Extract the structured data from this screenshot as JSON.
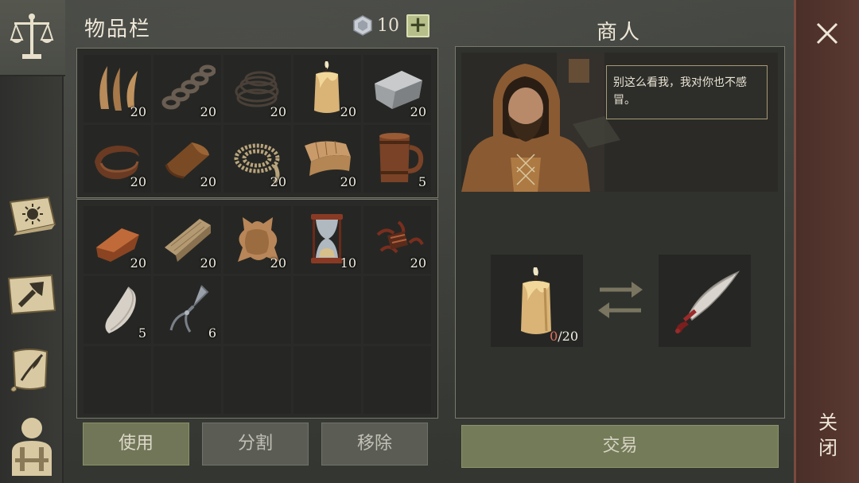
{
  "inventory": {
    "title": "物品栏",
    "currency_count": "10",
    "add_label": "+",
    "top_slots": [
      {
        "icon": "fiber-icon",
        "qty": "20"
      },
      {
        "icon": "chain-icon",
        "qty": "20"
      },
      {
        "icon": "wire-icon",
        "qty": "20"
      },
      {
        "icon": "candle-icon",
        "qty": "20"
      },
      {
        "icon": "stone-block-icon",
        "qty": "20"
      },
      {
        "icon": "leather-strip-icon",
        "qty": "20"
      },
      {
        "icon": "leather-roll-icon",
        "qty": "20"
      },
      {
        "icon": "rope-icon",
        "qty": "20"
      },
      {
        "icon": "cloth-icon",
        "qty": "20"
      },
      {
        "icon": "wooden-mug-icon",
        "qty": "5"
      }
    ],
    "bottom_slots": [
      {
        "icon": "copper-ingot-icon",
        "qty": "20"
      },
      {
        "icon": "wood-plank-icon",
        "qty": "20"
      },
      {
        "icon": "animal-hide-icon",
        "qty": "20"
      },
      {
        "icon": "hourglass-icon",
        "qty": "10"
      },
      {
        "icon": "scrap-pile-icon",
        "qty": "20"
      },
      {
        "icon": "fang-icon",
        "qty": "5"
      },
      {
        "icon": "fork-icon",
        "qty": "6"
      },
      {
        "icon": "",
        "qty": ""
      },
      {
        "icon": "",
        "qty": ""
      },
      {
        "icon": "",
        "qty": ""
      },
      {
        "icon": "",
        "qty": ""
      },
      {
        "icon": "",
        "qty": ""
      },
      {
        "icon": "",
        "qty": ""
      },
      {
        "icon": "",
        "qty": ""
      },
      {
        "icon": "",
        "qty": ""
      }
    ],
    "buttons": {
      "use": "使用",
      "split": "分割",
      "remove": "移除"
    }
  },
  "merchant": {
    "title": "商人",
    "speech": "别这么看我，我对你也不感冒。",
    "give_item": {
      "icon": "candle-icon",
      "have": "0",
      "need": "/20"
    },
    "get_item": {
      "icon": "scimitar-icon"
    },
    "trade_label": "交易"
  },
  "close": {
    "label": "关闭"
  },
  "sidebar": [
    {
      "icon": "scales-icon",
      "active": true
    },
    {
      "icon": "sun-book-icon"
    },
    {
      "icon": "hammer-map-icon"
    },
    {
      "icon": "quill-scroll-icon"
    },
    {
      "icon": "character-icon"
    }
  ],
  "colors": {
    "accent_green": "#737b58",
    "close_bar": "#5a3a32",
    "missing_count": "#e0705f"
  }
}
